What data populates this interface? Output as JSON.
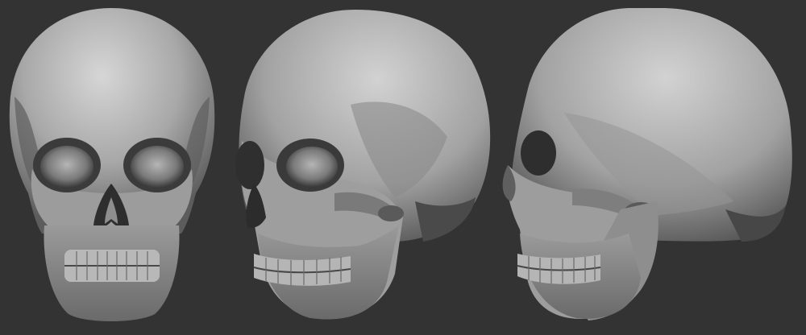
{
  "scene": {
    "background": "#333333",
    "material": {
      "base": "#a6a6a6",
      "highlight": "#d4d4d4",
      "shadow": "#5a5a5a",
      "deep_shadow": "#1e1e1e"
    },
    "views": [
      {
        "id": "front",
        "label": ""
      },
      {
        "id": "three-quarter",
        "label": ""
      },
      {
        "id": "side",
        "label": ""
      }
    ]
  }
}
